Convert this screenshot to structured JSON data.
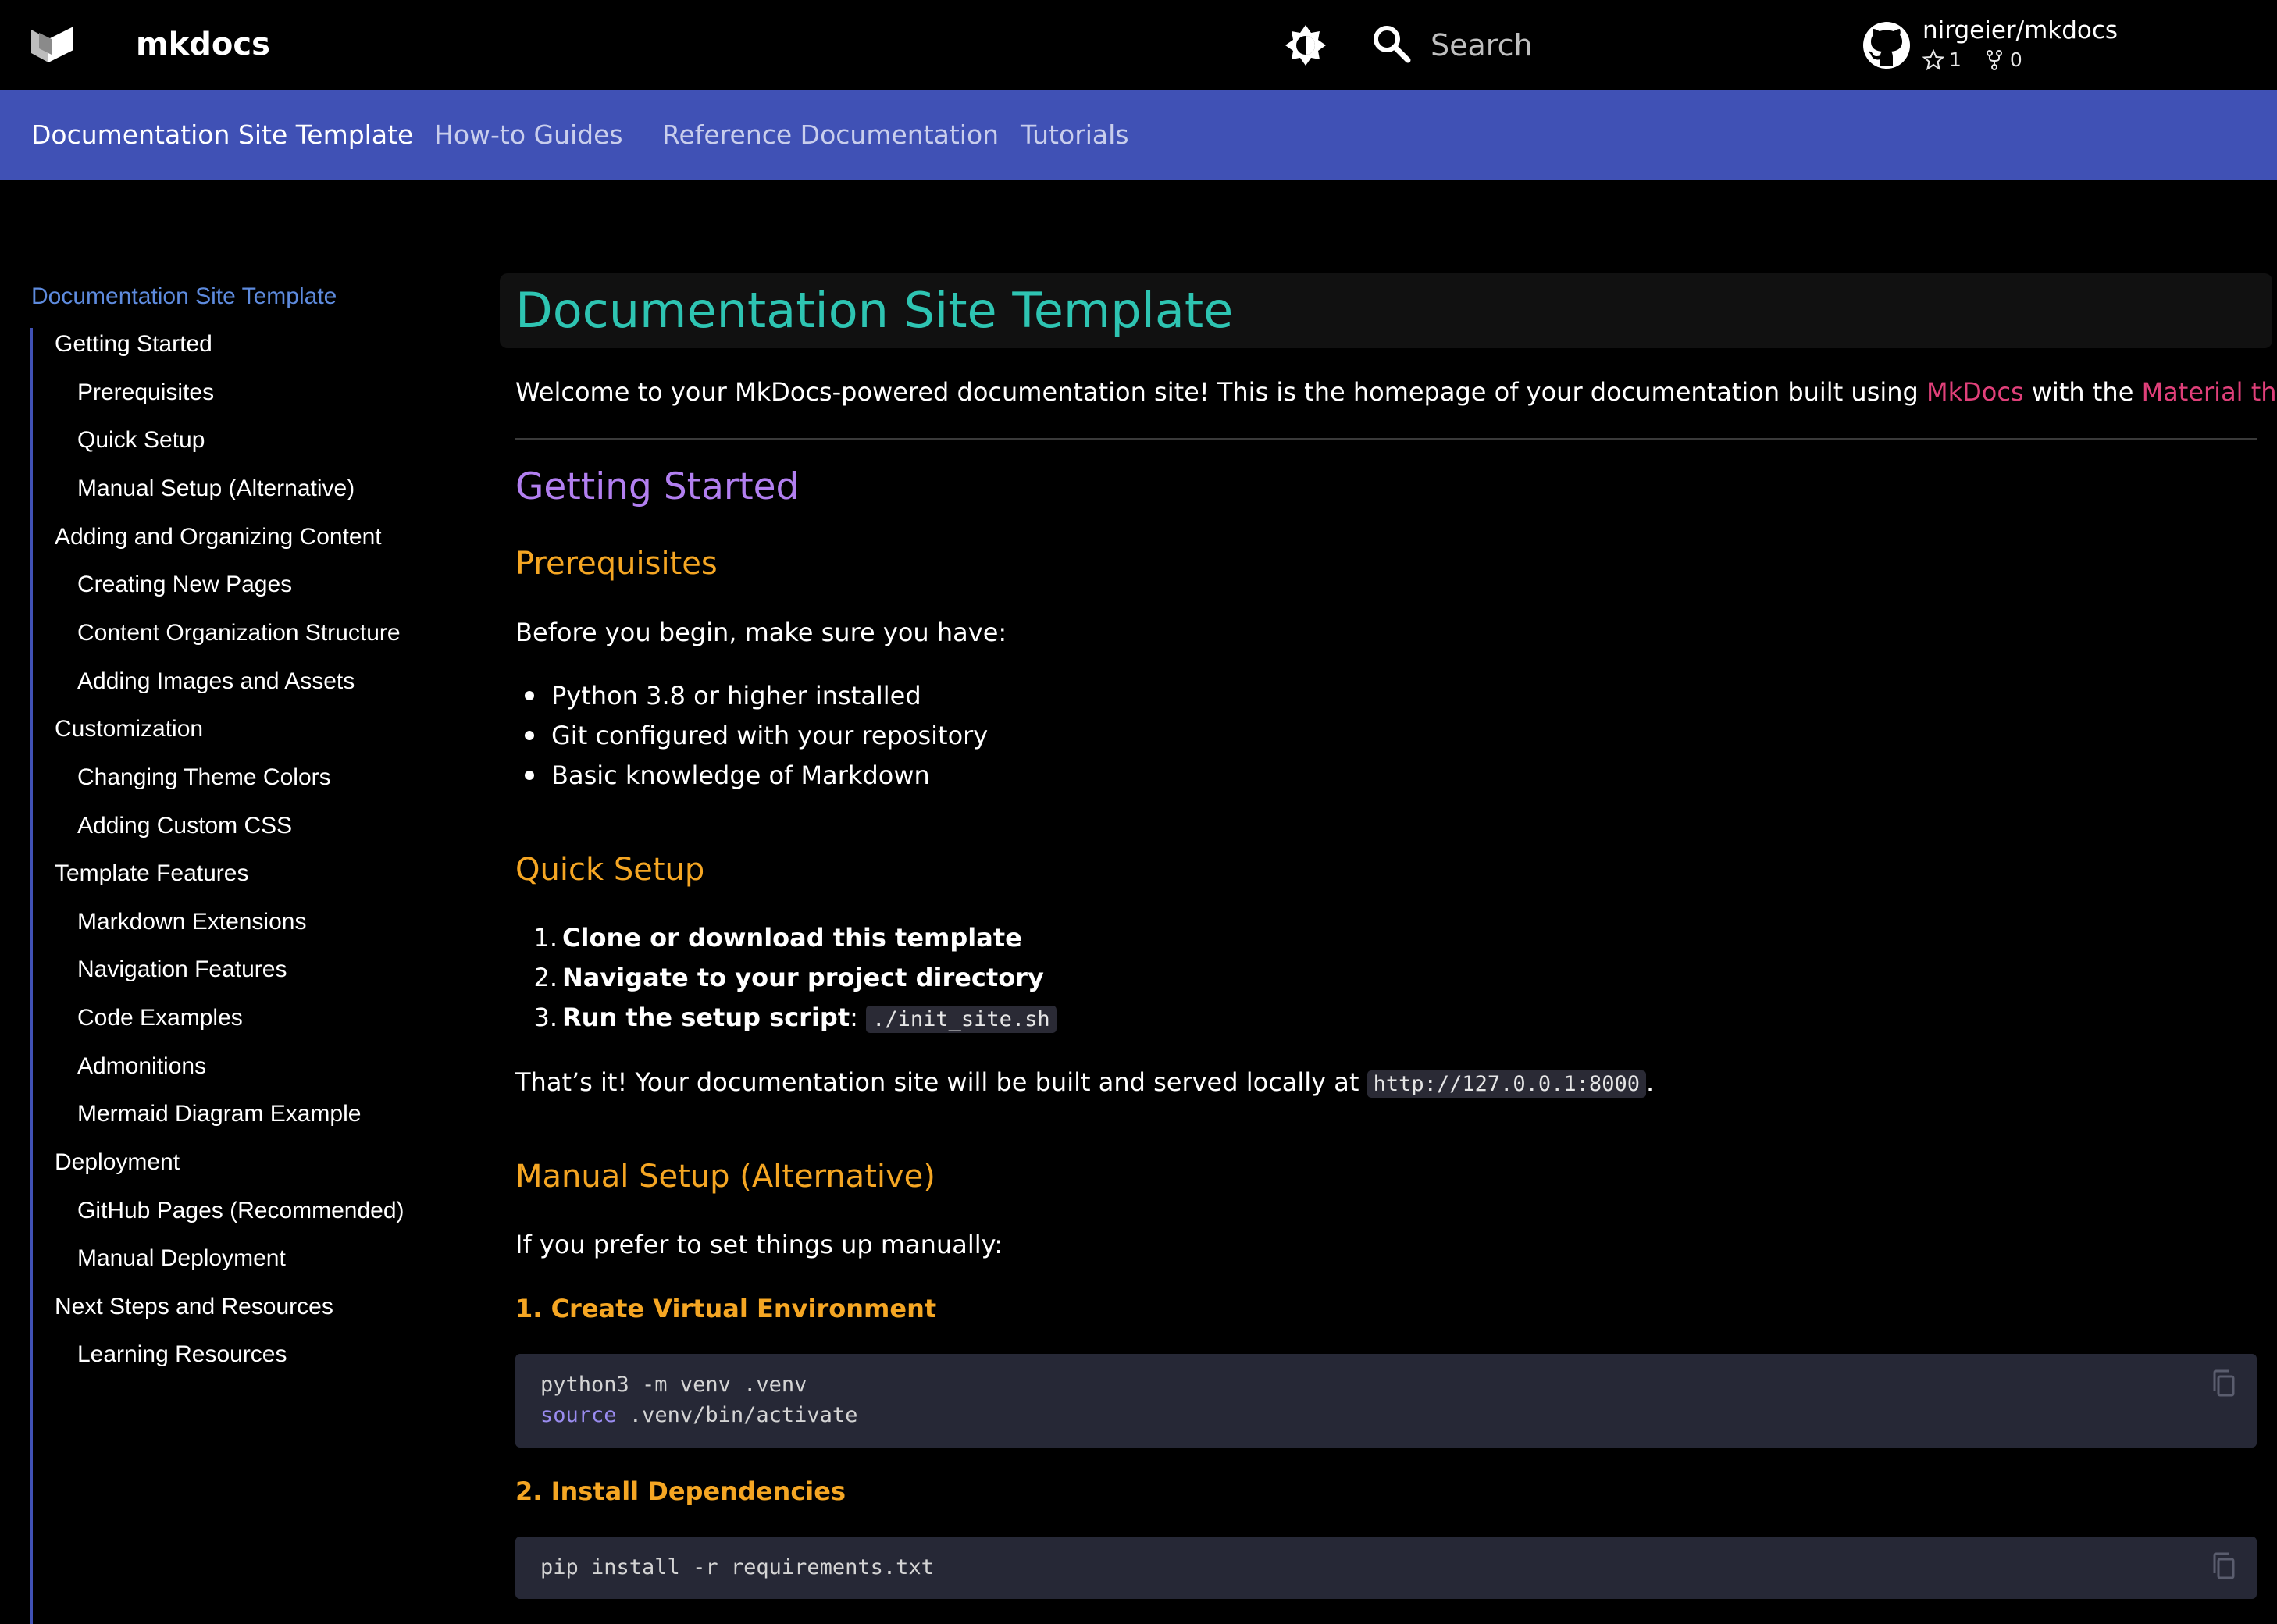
{
  "header": {
    "site_name": "mkdocs",
    "logo_icon": "material-logo-icon",
    "theme_toggle_icon": "brightness-auto-icon",
    "search_icon": "search-icon",
    "search_placeholder": "Search",
    "repo": {
      "icon": "github-icon",
      "name": "nirgeier/mkdocs",
      "stars": "1",
      "forks": "0"
    }
  },
  "tabs": [
    {
      "label": "Documentation Site Template",
      "active": true
    },
    {
      "label": "How-to Guides",
      "active": false
    },
    {
      "label": "Reference Documentation",
      "active": false
    },
    {
      "label": "Tutorials",
      "active": false
    }
  ],
  "sidebar": {
    "title": "Documentation Site Template",
    "items": [
      {
        "label": "Getting Started",
        "level": 1
      },
      {
        "label": "Prerequisites",
        "level": 2
      },
      {
        "label": "Quick Setup",
        "level": 2
      },
      {
        "label": "Manual Setup (Alternative)",
        "level": 2
      },
      {
        "label": "Adding and Organizing Content",
        "level": 1
      },
      {
        "label": "Creating New Pages",
        "level": 2
      },
      {
        "label": "Content Organization Structure",
        "level": 2
      },
      {
        "label": "Adding Images and Assets",
        "level": 2
      },
      {
        "label": "Customization",
        "level": 1
      },
      {
        "label": "Changing Theme Colors",
        "level": 2
      },
      {
        "label": "Adding Custom CSS",
        "level": 2
      },
      {
        "label": "Template Features",
        "level": 1
      },
      {
        "label": "Markdown Extensions",
        "level": 2
      },
      {
        "label": "Navigation Features",
        "level": 2
      },
      {
        "label": "Code Examples",
        "level": 2
      },
      {
        "label": "Admonitions",
        "level": 2
      },
      {
        "label": "Mermaid Diagram Example",
        "level": 2
      },
      {
        "label": "Deployment",
        "level": 1
      },
      {
        "label": "GitHub Pages (Recommended)",
        "level": 2
      },
      {
        "label": "Manual Deployment",
        "level": 2
      },
      {
        "label": "Next Steps and Resources",
        "level": 1
      },
      {
        "label": "Learning Resources",
        "level": 2
      }
    ]
  },
  "content": {
    "title": "Documentation Site Template",
    "intro": {
      "before": "Welcome to your MkDocs-powered documentation site! This is the homepage of your documentation built using ",
      "link1": "MkDocs",
      "middle": " with the ",
      "link2": "Material theme",
      "after": "."
    },
    "getting_started": "Getting Started",
    "prerequisites": {
      "heading": "Prerequisites",
      "lead": "Before you begin, make sure you have:",
      "items": [
        "Python 3.8 or higher installed",
        "Git configured with your repository",
        "Basic knowledge of Markdown"
      ]
    },
    "quick_setup": {
      "heading": "Quick Setup",
      "steps": [
        {
          "num": "1.",
          "text": "Clone or download this template"
        },
        {
          "num": "2.",
          "text": "Navigate to your project directory"
        },
        {
          "num": "3.",
          "text": "Run the setup script",
          "suffix": ": ",
          "code": "./init_site.sh"
        }
      ],
      "outro_before": "That’s it! Your documentation site will be built and served locally at ",
      "outro_code": "http://127.0.0.1:8000",
      "outro_after": "."
    },
    "manual_setup": {
      "heading": "Manual Setup (Alternative)",
      "lead": "If you prefer to set things up manually:",
      "step1_heading": "1. Create Virtual Environment",
      "step1_code_line1": "python3 -m venv .venv",
      "step1_code_line2_kw": "source",
      "step1_code_line2_rest": " .venv/bin/activate",
      "step2_heading": "2. Install Dependencies",
      "step2_code": "pip install -r requirements.txt"
    }
  },
  "colors": {
    "tab_bar": "#4051b5",
    "title": "#2ec4b2",
    "h2": "#b27ff0",
    "h3": "#f5a623",
    "link": "#e0407a",
    "sidebar_title": "#5e8bde"
  }
}
